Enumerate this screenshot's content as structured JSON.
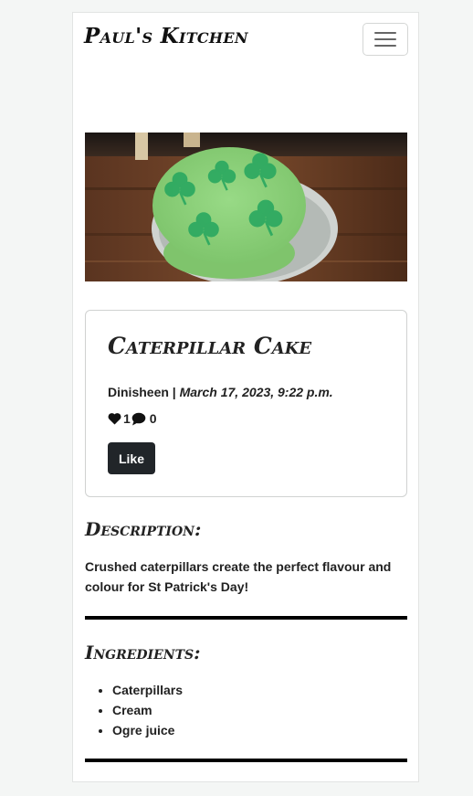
{
  "navbar": {
    "brand": "Paul's Kitchen",
    "toggle_icon": "hamburger-menu-icon"
  },
  "recipe": {
    "image_alt": "Green cake decorated with shamrocks",
    "title": "Caterpillar Cake",
    "author": "Dinisheen",
    "separator": " | ",
    "date": "March 17, 2023, 9:22 p.m.",
    "likes": "1",
    "comments": "0",
    "like_icon": "heart-icon",
    "comment_icon": "comment-icon",
    "like_button": "Like"
  },
  "description": {
    "heading": "Description:",
    "text": "Crushed caterpillars create the perfect flavour and colour for St Patrick's Day!"
  },
  "ingredients": {
    "heading": "Ingredients:",
    "items": [
      "Caterpillars",
      "Cream",
      "Ogre juice"
    ]
  },
  "colors": {
    "button_bg": "#212529",
    "rule": "#000000",
    "cake_green": "#8ed27a",
    "shamrock": "#2aa860"
  }
}
